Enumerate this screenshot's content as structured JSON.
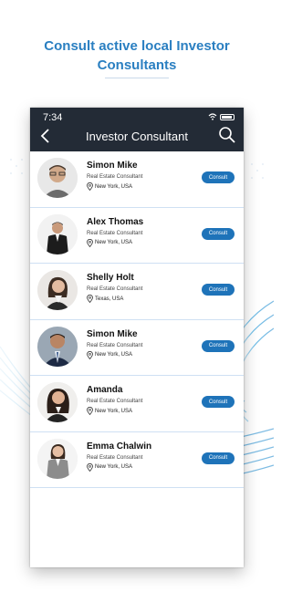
{
  "headline": {
    "line1": "Consult active local Investor",
    "line2": "Consultants"
  },
  "status_bar": {
    "time": "7:34"
  },
  "appbar": {
    "title": "Investor Consultant",
    "back_icon": "chevron-left-icon",
    "search_icon": "search-icon"
  },
  "consultants": [
    {
      "name": "Simon Mike",
      "role": "Real Estate Consultant",
      "location": "New York, USA",
      "button": "Consult"
    },
    {
      "name": "Alex Thomas",
      "role": "Real Estate Consultant",
      "location": "New York, USA",
      "button": "Consult"
    },
    {
      "name": "Shelly Holt",
      "role": "Real Estate Consultant",
      "location": "Texas, USA",
      "button": "Consult"
    },
    {
      "name": "Simon Mike",
      "role": "Real Estate Consultant",
      "location": "New York, USA",
      "button": "Consult"
    },
    {
      "name": "Amanda",
      "role": "Real Estate Consultant",
      "location": "New York, USA",
      "button": "Consult"
    },
    {
      "name": "Emma Chalwin",
      "role": "Real Estate Consultant",
      "location": "New York, USA",
      "button": "Consult"
    }
  ],
  "colors": {
    "accent": "#2a7fc1",
    "appbar": "#232b36",
    "button": "#1e73b9",
    "divider": "#cfe0f3"
  }
}
